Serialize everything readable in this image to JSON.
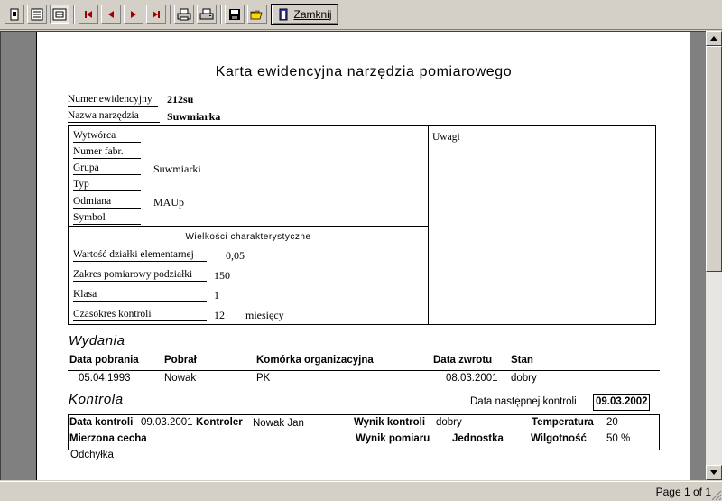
{
  "toolbar": {
    "close_label": "Zamknij",
    "buttons": [
      "single-page-icon",
      "multi-page-icon",
      "zoom-page-icon",
      "first-page-icon",
      "prev-page-icon",
      "next-page-icon",
      "last-page-icon",
      "printer-setup-icon",
      "print-icon",
      "save-icon",
      "open-icon"
    ]
  },
  "report": {
    "title": "Karta ewidencyjna narzędzia pomiarowego",
    "numer_label": "Numer ewidencyjny",
    "numer_value": "212su",
    "nazwa_label": "Nazwa narzędzia",
    "nazwa_value": "Suwmiarka",
    "wytworca_label": "Wytwórca",
    "numer_fabr_label": "Numer fabr.",
    "grupa_label": "Grupa",
    "grupa_value": "Suwmiarki",
    "typ_label": "Typ",
    "odmiana_label": "Odmiana",
    "odmiana_value": "MAUp",
    "symbol_label": "Symbol",
    "uwagi_label": "Uwagi",
    "wielkosci_header": "Wielkości charakterystyczne",
    "wartosc_label": "Wartość działki elementarnej",
    "wartosc_value": "0,05",
    "zakres_label": "Zakres pomiarowy podziałki",
    "zakres_value": "150",
    "klasa_label": "Klasa",
    "klasa_value": "1",
    "czasokres_label": "Czasokres kontroli",
    "czasokres_value": "12",
    "czasokres_unit": "miesięcy"
  },
  "wydania": {
    "title": "Wydania",
    "headers": [
      "Data pobrania",
      "Pobrał",
      "Komórka organizacyjna",
      "Data zwrotu",
      "Stan"
    ],
    "row": [
      "05.04.1993",
      "Nowak",
      "PK",
      "08.03.2001",
      "dobry"
    ]
  },
  "kontrola": {
    "title": "Kontrola",
    "next_label": "Data następnej kontroli",
    "next_value": "09.03.2002",
    "data_label": "Data kontroli",
    "data_value": "09.03.2001",
    "kontroler_label": "Kontroler",
    "kontroler_value": "Nowak Jan",
    "wynik_label": "Wynik kontroli",
    "wynik_value": "dobry",
    "temp_label": "Temperatura",
    "temp_value": "20",
    "mierzona_label": "Mierzona cecha",
    "wynik_pomiaru_label": "Wynik pomiaru",
    "jednostka_label": "Jednostka",
    "wilgotnosc_label": "Wilgotność",
    "wilgotnosc_value": "50 %",
    "odchylka_label": "Odchyłka"
  },
  "status": {
    "page": "Page 1 of 1"
  }
}
